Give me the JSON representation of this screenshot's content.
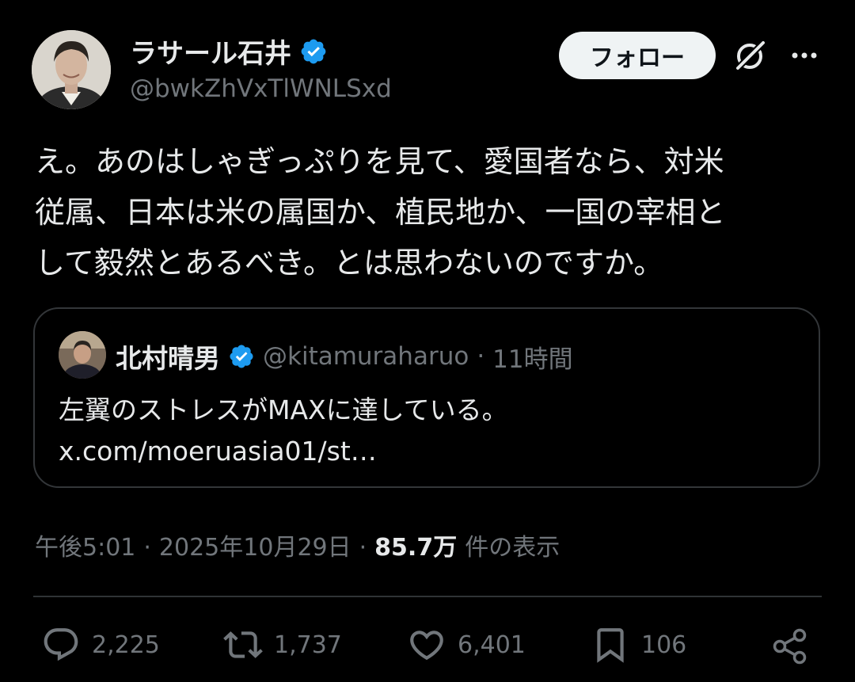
{
  "author": {
    "name": "ラサール石井",
    "handle": "@bwkZhVxTlWNLSxd"
  },
  "follow_label": "フォロー",
  "tweet_lines": [
    "え。あのはしゃぎっぷりを見て、愛国者なら、対米",
    "従属、日本は米の属国か、植民地か、一国の宰相と",
    "して毅然とあるべき。とは思わないのですか。"
  ],
  "quote": {
    "name": "北村晴男",
    "handle": "@kitamuraharuo",
    "separator": "·",
    "time": "11時間",
    "text": "左翼のストレスがMAXに達している。",
    "link": "x.com/moeruasia01/st…"
  },
  "meta": {
    "time": "午後5:01",
    "sep1": "·",
    "date": "2025年10月29日",
    "sep2": "·",
    "views_count": "85.7万",
    "views_label": "件の表示"
  },
  "actions": {
    "replies": "2,225",
    "reposts": "1,737",
    "likes": "6,401",
    "bookmarks": "106"
  },
  "colors": {
    "background": "#000000",
    "text": "#e7e9ea",
    "secondary": "#71767b",
    "verified": "#1d9bf0",
    "border": "#333639"
  }
}
